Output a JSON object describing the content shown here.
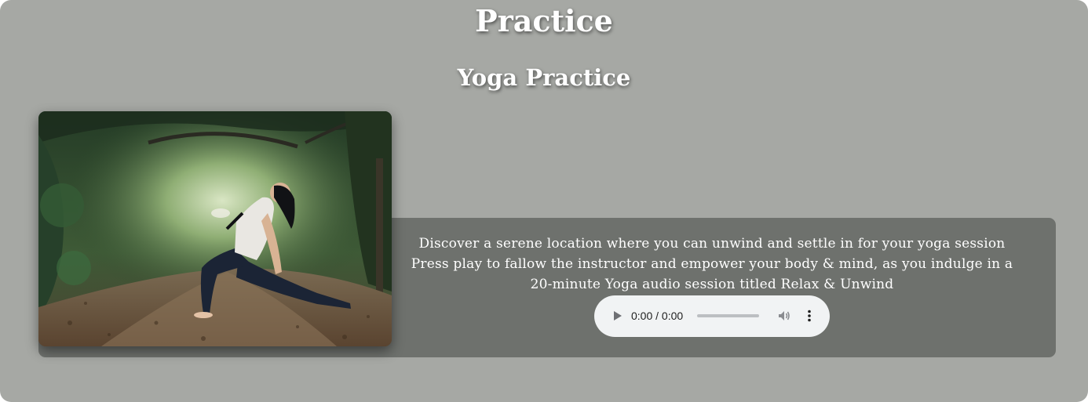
{
  "page": {
    "title": "Practice",
    "section_title": "Yoga Practice"
  },
  "card": {
    "description": "Discover a serene location where you can unwind and settle in for your yoga session Press play to fallow the instructor and empower your body & mind, as you indulge in a 20-minute Yoga audio session titled Relax & Unwind",
    "photo_icon": "yoga-photo"
  },
  "audio_player": {
    "time": "0:00 / 0:00",
    "progress": 0,
    "icons": {
      "play": "play-icon",
      "volume": "volume-icon",
      "more": "more-vert-icon"
    }
  },
  "colors": {
    "background": "#a6a8a4",
    "card": "#6e716d",
    "heading_text": "#ffffff",
    "player_bg": "#f1f3f4"
  }
}
